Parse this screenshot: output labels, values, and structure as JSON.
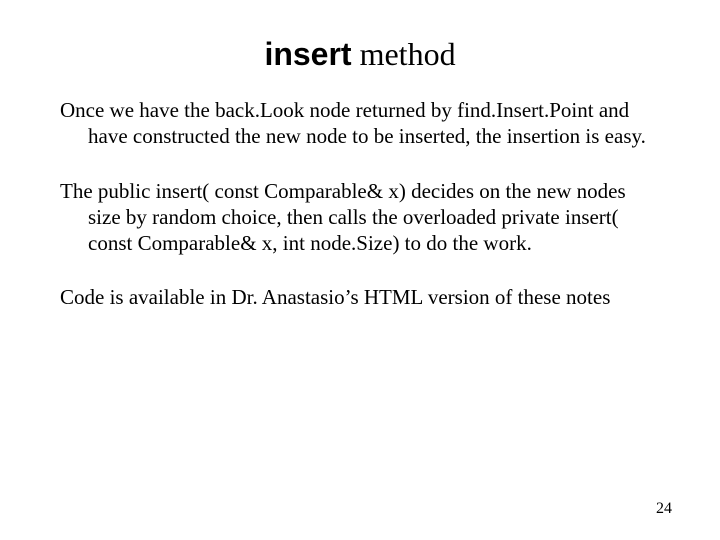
{
  "title": {
    "code_word": "insert",
    "rest": " method"
  },
  "paragraphs": {
    "p1": "Once we have the back.Look node returned by find.Insert.Point and have constructed the new node to be inserted, the insertion is easy.",
    "p2": "The public insert( const Comparable& x) decides on the new nodes size by random choice, then calls the overloaded private insert( const Comparable& x, int node.Size) to do the work.",
    "p3": "Code is available in Dr. Anastasio’s HTML version of these notes"
  },
  "page_number": "24"
}
